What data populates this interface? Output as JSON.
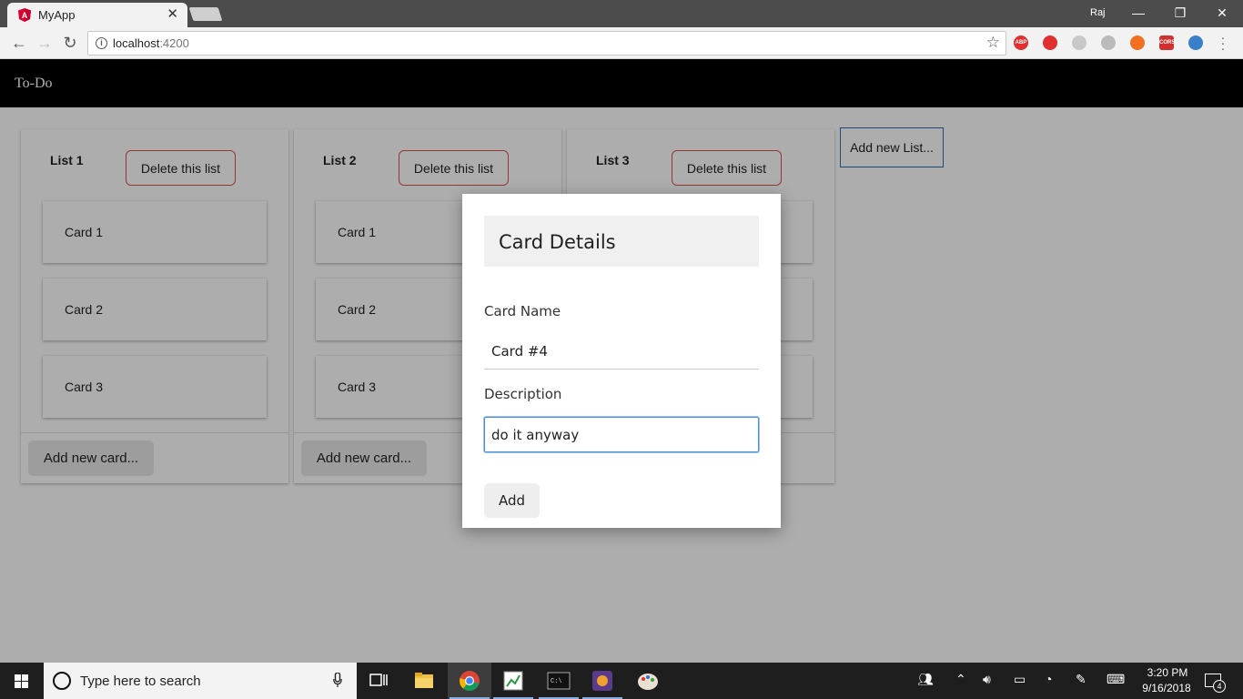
{
  "browser": {
    "tab_title": "MyApp",
    "profile": "Raj",
    "url_host": "localhost",
    "url_port": ":4200",
    "extensions": [
      {
        "name": "abp-extension-icon",
        "label": "ABP",
        "color": "#e03030"
      },
      {
        "name": "opera-extension-icon",
        "label": "",
        "color": "#e03030"
      },
      {
        "name": "puzzle-extension-icon",
        "label": "",
        "color": "#c8c8c8"
      },
      {
        "name": "circle-extension-icon",
        "label": "",
        "color": "#bbbbbb"
      },
      {
        "name": "fire-extension-icon",
        "label": "",
        "color": "#f07020"
      },
      {
        "name": "cors-extension-icon",
        "label": "CORS",
        "color": "#d03030"
      },
      {
        "name": "download-extension-icon",
        "label": "",
        "color": "#3a80c8"
      }
    ]
  },
  "app": {
    "header_title": "To-Do",
    "add_list_label": "Add new List...",
    "delete_list_label": "Delete this list",
    "add_card_label": "Add new card...",
    "lists": [
      {
        "title": "List 1",
        "cards": [
          "Card 1",
          "Card 2",
          "Card 3"
        ]
      },
      {
        "title": "List 2",
        "cards": [
          "Card 1",
          "Card 2",
          "Card 3"
        ]
      },
      {
        "title": "List 3",
        "cards": [
          "",
          "",
          ""
        ]
      }
    ]
  },
  "modal": {
    "title": "Card Details",
    "name_label": "Card Name",
    "name_value": "Card #4",
    "description_label": "Description",
    "description_value": "do it anyway",
    "add_label": "Add"
  },
  "taskbar": {
    "search_placeholder": "Type here to search",
    "time": "3:20 PM",
    "date": "9/16/2018",
    "notification_count": "4"
  },
  "colors": {
    "header_bg": "#000000",
    "delete_border": "#d9534f",
    "focus_blue": "#4a90d9"
  }
}
